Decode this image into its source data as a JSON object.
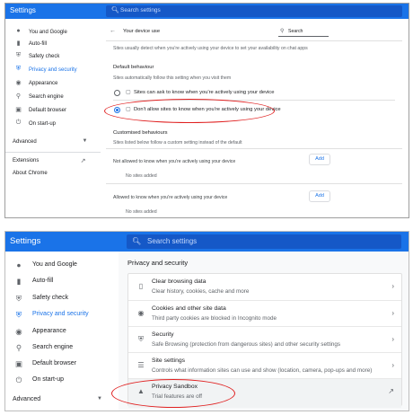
{
  "colors": {
    "accent": "#1a73e8",
    "annotation": "#e02020"
  },
  "panel_a": {
    "app_title": "Settings",
    "search_placeholder": "Search settings",
    "nav": [
      {
        "label": "You and Google",
        "icon": "person-icon"
      },
      {
        "label": "Auto-fill",
        "icon": "clipboard-icon"
      },
      {
        "label": "Safety check",
        "icon": "shield-check-icon"
      },
      {
        "label": "Privacy and security",
        "icon": "shield-icon",
        "active": true
      },
      {
        "label": "Appearance",
        "icon": "palette-icon"
      },
      {
        "label": "Search engine",
        "icon": "search-icon"
      },
      {
        "label": "Default browser",
        "icon": "browser-icon"
      },
      {
        "label": "On start-up",
        "icon": "power-icon"
      }
    ],
    "advanced": "Advanced",
    "extensions": "Extensions",
    "about": "About Chrome",
    "page_title": "Your device use",
    "inner_search": "Search",
    "intro": "Sites usually detect when you're actively using your device to set your availability on chat apps",
    "default_behaviour": "Default behaviour",
    "default_sub": "Sites automatically follow this setting when you visit them",
    "option_allow": "Sites can ask to know when you're actively using your device",
    "option_block": "Don't allow sites to know when you're actively using your device",
    "custom_title": "Customised behaviours",
    "custom_sub": "Sites listed below follow a custom setting instead of the default",
    "not_allowed_label": "Not allowed to know when you're actively using your device",
    "allowed_label": "Allowed to know when you're actively using your device",
    "add_label": "Add",
    "no_sites": "No sites added"
  },
  "panel_b": {
    "app_title": "Settings",
    "search_placeholder": "Search settings",
    "nav": [
      {
        "label": "You and Google",
        "icon": "person-icon"
      },
      {
        "label": "Auto-fill",
        "icon": "clipboard-icon"
      },
      {
        "label": "Safety check",
        "icon": "shield-check-icon"
      },
      {
        "label": "Privacy and security",
        "icon": "shield-icon",
        "active": true
      },
      {
        "label": "Appearance",
        "icon": "palette-icon"
      },
      {
        "label": "Search engine",
        "icon": "search-icon"
      },
      {
        "label": "Default browser",
        "icon": "browser-icon"
      },
      {
        "label": "On start-up",
        "icon": "power-icon"
      }
    ],
    "advanced": "Advanced",
    "section_title": "Privacy and security",
    "rows": [
      {
        "title": "Clear browsing data",
        "subtitle": "Clear history, cookies, cache and more",
        "icon": "trash-icon"
      },
      {
        "title": "Cookies and other site data",
        "subtitle": "Third party cookies are blocked in Incognito mode",
        "icon": "cookie-icon"
      },
      {
        "title": "Security",
        "subtitle": "Safe Browsing (protection from dangerous sites) and other security settings",
        "icon": "shield-icon"
      },
      {
        "title": "Site settings",
        "subtitle": "Controls what information sites can use and show (location, camera, pop-ups and more)",
        "icon": "sliders-icon"
      },
      {
        "title": "Privacy Sandbox",
        "subtitle": "Trial features are off",
        "icon": "flask-icon"
      }
    ]
  }
}
